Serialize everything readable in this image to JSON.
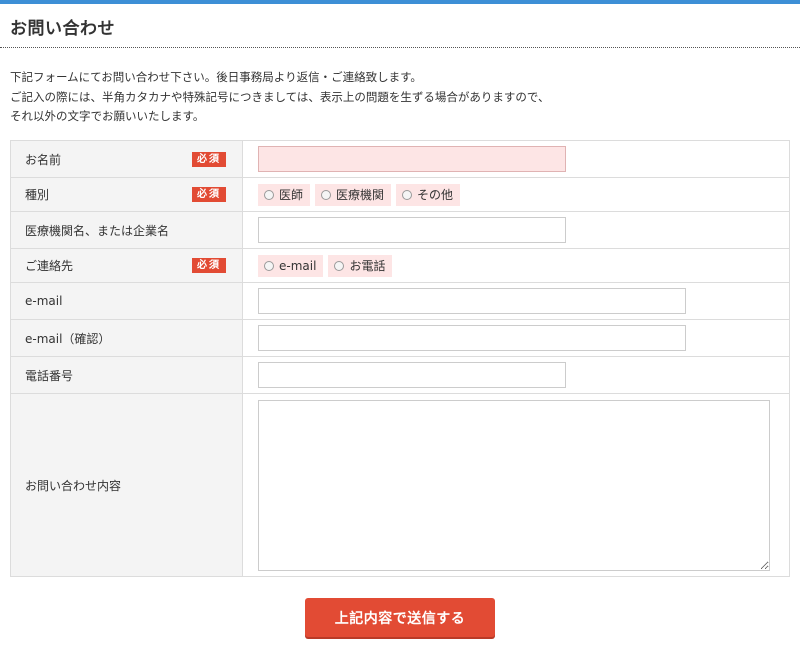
{
  "header": {
    "title": "お問い合わせ",
    "accent_color": "#3d8fd6"
  },
  "intro": {
    "line1": "下記フォームにてお問い合わせ下さい。後日事務局より返信・ご連絡致します。",
    "line2": "ご記入の際には、半角カタカナや特殊記号につきましては、表示上の問題を生ずる場合がありますので、",
    "line3": "それ以外の文字でお願いいたします。"
  },
  "form": {
    "required_badge": "必須",
    "name": {
      "label": "お名前",
      "value": ""
    },
    "category": {
      "label": "種別",
      "options": [
        "医師",
        "医療機関",
        "その他"
      ]
    },
    "organization": {
      "label": "医療機関名、または企業名",
      "value": ""
    },
    "contact_method": {
      "label": "ご連絡先",
      "options": [
        "e-mail",
        "お電話"
      ]
    },
    "email": {
      "label": "e-mail",
      "value": ""
    },
    "email_confirm": {
      "label": "e-mail（確認）",
      "value": ""
    },
    "phone": {
      "label": "電話番号",
      "value": ""
    },
    "inquiry": {
      "label": "お問い合わせ内容",
      "value": ""
    }
  },
  "submit": {
    "label": "上記内容で送信する",
    "color": "#e24b34"
  }
}
